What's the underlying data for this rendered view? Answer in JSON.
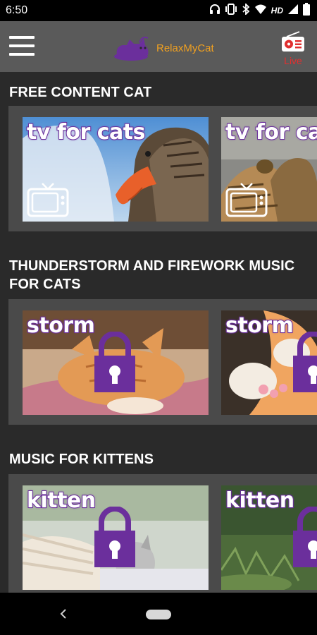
{
  "status_bar": {
    "time": "6:50",
    "network": "HD",
    "icons": [
      "headphones-icon",
      "vibrate-icon",
      "bluetooth-icon",
      "wifi-icon",
      "signal-icon",
      "battery-icon"
    ]
  },
  "app_bar": {
    "menu_icon": "hamburger-icon",
    "brand": "RelaxMyCat",
    "live_label": "Live",
    "accent": "#f0a020",
    "live_color": "#e03030"
  },
  "sections": [
    {
      "title": "FREE CONTENT CAT",
      "cards": [
        {
          "caption": "tv for cats",
          "badge": "tv-icon",
          "locked": false
        },
        {
          "caption": "tv for cats",
          "badge": "tv-icon",
          "locked": false
        }
      ]
    },
    {
      "title": "THUNDERSTORM AND FIREWORK MUSIC FOR CATS",
      "cards": [
        {
          "caption": "storm",
          "badge": "lock-icon",
          "locked": true
        },
        {
          "caption": "storm",
          "badge": "lock-icon",
          "locked": true
        }
      ]
    },
    {
      "title": "MUSIC FOR KITTENS",
      "cards": [
        {
          "caption": "kitten",
          "badge": "lock-icon",
          "locked": true
        },
        {
          "caption": "kitten",
          "badge": "lock-icon",
          "locked": true
        }
      ]
    }
  ],
  "colors": {
    "caption_outline": "#6b2f9c",
    "lock": "#6b2f9c",
    "background": "#2a2a2a",
    "strip": "#4a4a4a",
    "app_bar": "#5a5a5a"
  }
}
